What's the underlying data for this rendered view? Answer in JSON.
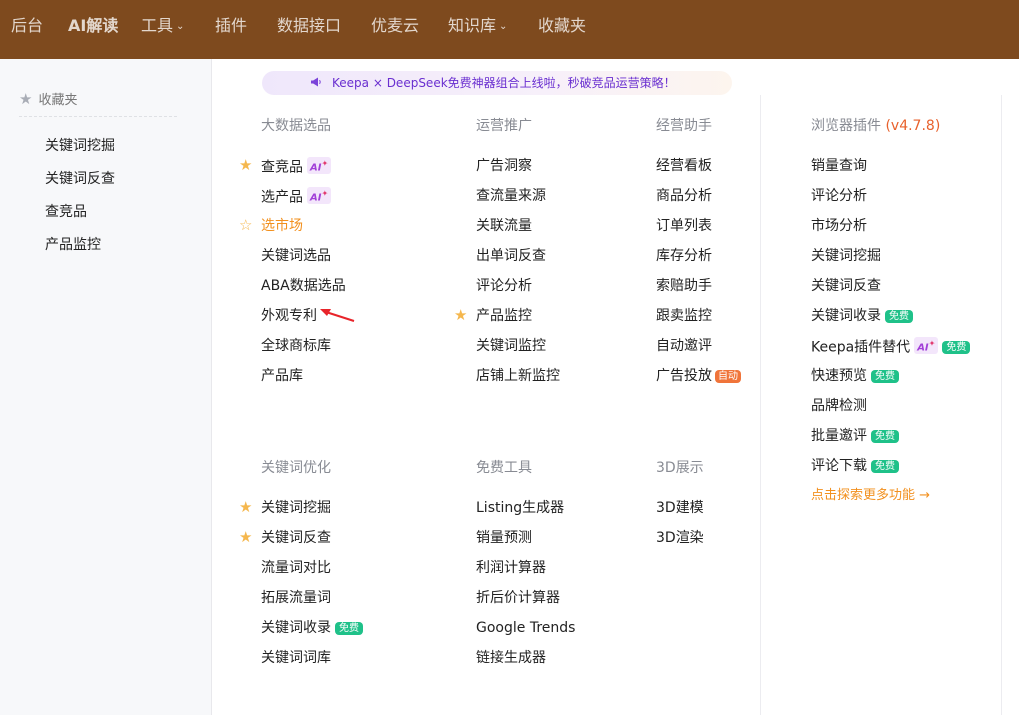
{
  "topnav": {
    "items": [
      {
        "label": "后台"
      },
      {
        "label": "AI解读"
      },
      {
        "label": "工具"
      },
      {
        "label": "插件"
      },
      {
        "label": "数据接口"
      },
      {
        "label": "优麦云"
      },
      {
        "label": "知识库"
      },
      {
        "label": "收藏夹"
      }
    ],
    "caret": "⌄",
    "background_color": "#7e4a1e"
  },
  "sidebar": {
    "title": "收藏夹",
    "title_icon": "star-icon",
    "items": [
      {
        "label": "关键词挖掘"
      },
      {
        "label": "关键词反查"
      },
      {
        "label": "查竞品"
      },
      {
        "label": "产品监控"
      }
    ]
  },
  "banner": {
    "icon": "megaphone-icon",
    "text": "Keepa × DeepSeek免费神器组合上线啦，秒破竞品运营策略！"
  },
  "tags": {
    "ai": "AI",
    "ai_spark": "✦",
    "free": "免费",
    "auto": "自动"
  },
  "icons": {
    "star": "★",
    "star_outline": "☆",
    "accent_color": "#f2901e",
    "free_tag_color": "#1fc189"
  },
  "menu": {
    "big_data": {
      "title": "大数据选品",
      "items": [
        {
          "label": "查竞品"
        },
        {
          "label": "选产品"
        },
        {
          "label": "选市场"
        },
        {
          "label": "关键词选品"
        },
        {
          "label": "ABA数据选品"
        },
        {
          "label": "外观专利"
        },
        {
          "label": "全球商标库"
        },
        {
          "label": "产品库"
        }
      ]
    },
    "operations": {
      "title": "运营推广",
      "items": [
        {
          "label": "广告洞察"
        },
        {
          "label": "查流量来源"
        },
        {
          "label": "关联流量"
        },
        {
          "label": "出单词反查"
        },
        {
          "label": "评论分析"
        },
        {
          "label": "产品监控"
        },
        {
          "label": "关键词监控"
        },
        {
          "label": "店铺上新监控"
        }
      ]
    },
    "business": {
      "title": "经营助手",
      "items": [
        {
          "label": "经营看板"
        },
        {
          "label": "商品分析"
        },
        {
          "label": "订单列表"
        },
        {
          "label": "库存分析"
        },
        {
          "label": "索赔助手"
        },
        {
          "label": "跟卖监控"
        },
        {
          "label": "自动邀评"
        },
        {
          "label": "广告投放"
        }
      ]
    },
    "keyword_opt": {
      "title": "关键词优化",
      "items": [
        {
          "label": "关键词挖掘"
        },
        {
          "label": "关键词反查"
        },
        {
          "label": "流量词对比"
        },
        {
          "label": "拓展流量词"
        },
        {
          "label": "关键词收录"
        },
        {
          "label": "关键词词库"
        }
      ]
    },
    "free_tools": {
      "title": "免费工具",
      "items": [
        {
          "label": "Listing生成器"
        },
        {
          "label": "销量预测"
        },
        {
          "label": "利润计算器"
        },
        {
          "label": "折后价计算器"
        },
        {
          "label": "Google Trends"
        },
        {
          "label": "链接生成器"
        }
      ]
    },
    "display_3d": {
      "title": "3D展示",
      "items": [
        {
          "label": "3D建模"
        },
        {
          "label": "3D渲染"
        }
      ]
    },
    "plugin": {
      "title": "浏览器插件",
      "version": "(v4.7.8)",
      "items": [
        {
          "label": "销量查询"
        },
        {
          "label": "评论分析"
        },
        {
          "label": "市场分析"
        },
        {
          "label": "关键词挖掘"
        },
        {
          "label": "关键词反查"
        },
        {
          "label": "关键词收录"
        },
        {
          "label": "Keepa插件替代"
        },
        {
          "label": "快速预览"
        },
        {
          "label": "品牌检测"
        },
        {
          "label": "批量邀评"
        },
        {
          "label": "评论下载"
        }
      ],
      "more_label": "点击探索更多功能",
      "more_arrow": "→"
    }
  }
}
